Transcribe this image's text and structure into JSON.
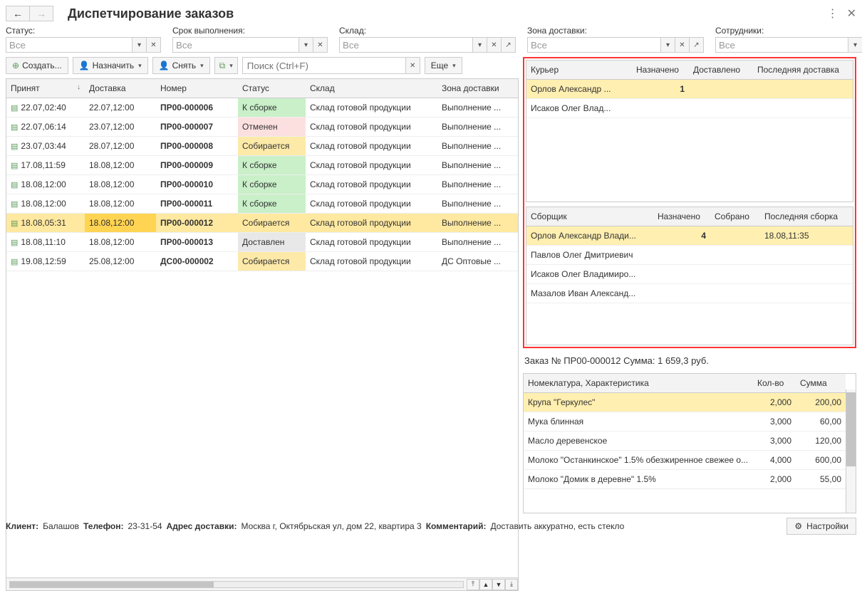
{
  "title": "Диспетчирование заказов",
  "filters": {
    "status": {
      "label": "Статус:",
      "value": "Все"
    },
    "deadline": {
      "label": "Срок выполнения:",
      "value": "Все"
    },
    "warehouse": {
      "label": "Склад:",
      "value": "Все"
    },
    "zone": {
      "label": "Зона доставки:",
      "value": "Все"
    },
    "staff": {
      "label": "Сотрудники:",
      "value": "Все"
    }
  },
  "toolbar": {
    "create": "Создать...",
    "assign": "Назначить",
    "revoke": "Снять",
    "more": "Еще"
  },
  "search_placeholder": "Поиск (Ctrl+F)",
  "orders": {
    "headers": [
      "Принят",
      "Доставка",
      "Номер",
      "Статус",
      "Склад",
      "Зона доставки"
    ],
    "rows": [
      {
        "accepted": "22.07,02:40",
        "delivery": "22.07,12:00",
        "num": "ПР00-000006",
        "status": "К сборке",
        "status_color": "green",
        "warehouse": "Склад готовой продукции",
        "zone": "Выполнение ...",
        "sel": false
      },
      {
        "accepted": "22.07,06:14",
        "delivery": "23.07,12:00",
        "num": "ПР00-000007",
        "status": "Отменен",
        "status_color": "red",
        "warehouse": "Склад готовой продукции",
        "zone": "Выполнение ...",
        "sel": false
      },
      {
        "accepted": "23.07,03:44",
        "delivery": "28.07,12:00",
        "num": "ПР00-000008",
        "status": "Собирается",
        "status_color": "yellow",
        "warehouse": "Склад готовой продукции",
        "zone": "Выполнение ...",
        "sel": false
      },
      {
        "accepted": "17.08,11:59",
        "delivery": "18.08,12:00",
        "num": "ПР00-000009",
        "status": "К сборке",
        "status_color": "green",
        "warehouse": "Склад готовой продукции",
        "zone": "Выполнение ...",
        "sel": false
      },
      {
        "accepted": "18.08,12:00",
        "delivery": "18.08,12:00",
        "num": "ПР00-000010",
        "status": "К сборке",
        "status_color": "green",
        "warehouse": "Склад готовой продукции",
        "zone": "Выполнение ...",
        "sel": false
      },
      {
        "accepted": "18.08,12:00",
        "delivery": "18.08,12:00",
        "num": "ПР00-000011",
        "status": "К сборке",
        "status_color": "green",
        "warehouse": "Склад готовой продукции",
        "zone": "Выполнение ...",
        "sel": false
      },
      {
        "accepted": "18.08,05:31",
        "delivery": "18.08,12:00",
        "num": "ПР00-000012",
        "status": "Собирается",
        "status_color": "yellow",
        "warehouse": "Склад готовой продукции",
        "zone": "Выполнение ...",
        "sel": true
      },
      {
        "accepted": "18.08,11:10",
        "delivery": "18.08,12:00",
        "num": "ПР00-000013",
        "status": "Доставлен",
        "status_color": "grey",
        "warehouse": "Склад готовой продукции",
        "zone": "Выполнение ...",
        "sel": false
      },
      {
        "accepted": "19.08,12:59",
        "delivery": "25.08,12:00",
        "num": "ДС00-000002",
        "status": "Собирается",
        "status_color": "yellow",
        "warehouse": "Склад готовой продукции",
        "zone": "ДС Оптовые ...",
        "sel": false
      }
    ]
  },
  "courier_panel": {
    "headers": [
      "Курьер",
      "Назначено",
      "Доставлено",
      "Последняя доставка"
    ],
    "rows": [
      {
        "name": "Орлов Александр ...",
        "assigned": "1",
        "delivered": "",
        "last": "",
        "hl": true
      },
      {
        "name": "Исаков Олег Влад...",
        "assigned": "",
        "delivered": "",
        "last": "",
        "hl": false
      }
    ]
  },
  "picker_panel": {
    "headers": [
      "Сборщик",
      "Назначено",
      "Собрано",
      "Последняя сборка"
    ],
    "rows": [
      {
        "name": "Орлов Александр Влади...",
        "assigned": "4",
        "picked": "",
        "last": "18.08,11:35",
        "hl": true
      },
      {
        "name": "Павлов Олег Дмитриевич",
        "assigned": "",
        "picked": "",
        "last": "",
        "hl": false
      },
      {
        "name": "Исаков Олег Владимиро...",
        "assigned": "",
        "picked": "",
        "last": "",
        "hl": false
      },
      {
        "name": "Мазалов Иван Александ...",
        "assigned": "",
        "picked": "",
        "last": "",
        "hl": false
      }
    ]
  },
  "order_summary": "Заказ № ПР00-000012   Сумма: 1 659,3 руб.",
  "items": {
    "headers": [
      "Номеклатура, Характеристика",
      "Кол-во",
      "Сумма"
    ],
    "rows": [
      {
        "name": "Крупа \"Геркулес\"",
        "qty": "2,000",
        "sum": "200,00",
        "hl": true
      },
      {
        "name": "Мука блинная",
        "qty": "3,000",
        "sum": "60,00",
        "hl": false
      },
      {
        "name": "Масло деревенское",
        "qty": "3,000",
        "sum": "120,00",
        "hl": false
      },
      {
        "name": "Молоко \"Останкинское\" 1.5% обезжиренное свежее о...",
        "qty": "4,000",
        "sum": "600,00",
        "hl": false
      },
      {
        "name": "Молоко \"Домик в деревне\" 1.5%",
        "qty": "2,000",
        "sum": "55,00",
        "hl": false
      }
    ]
  },
  "footer": {
    "client_lbl": "Клиент:",
    "client": "Балашов",
    "phone_lbl": "Телефон:",
    "phone": "23-31-54",
    "addr_lbl": "Адрес доставки:",
    "addr": "Москва г, Октябрьская ул, дом 22, квартира 3",
    "comment_lbl": "Комментарий:",
    "comment": "Доставить аккуратно, есть стекло",
    "settings": "Настройки"
  }
}
